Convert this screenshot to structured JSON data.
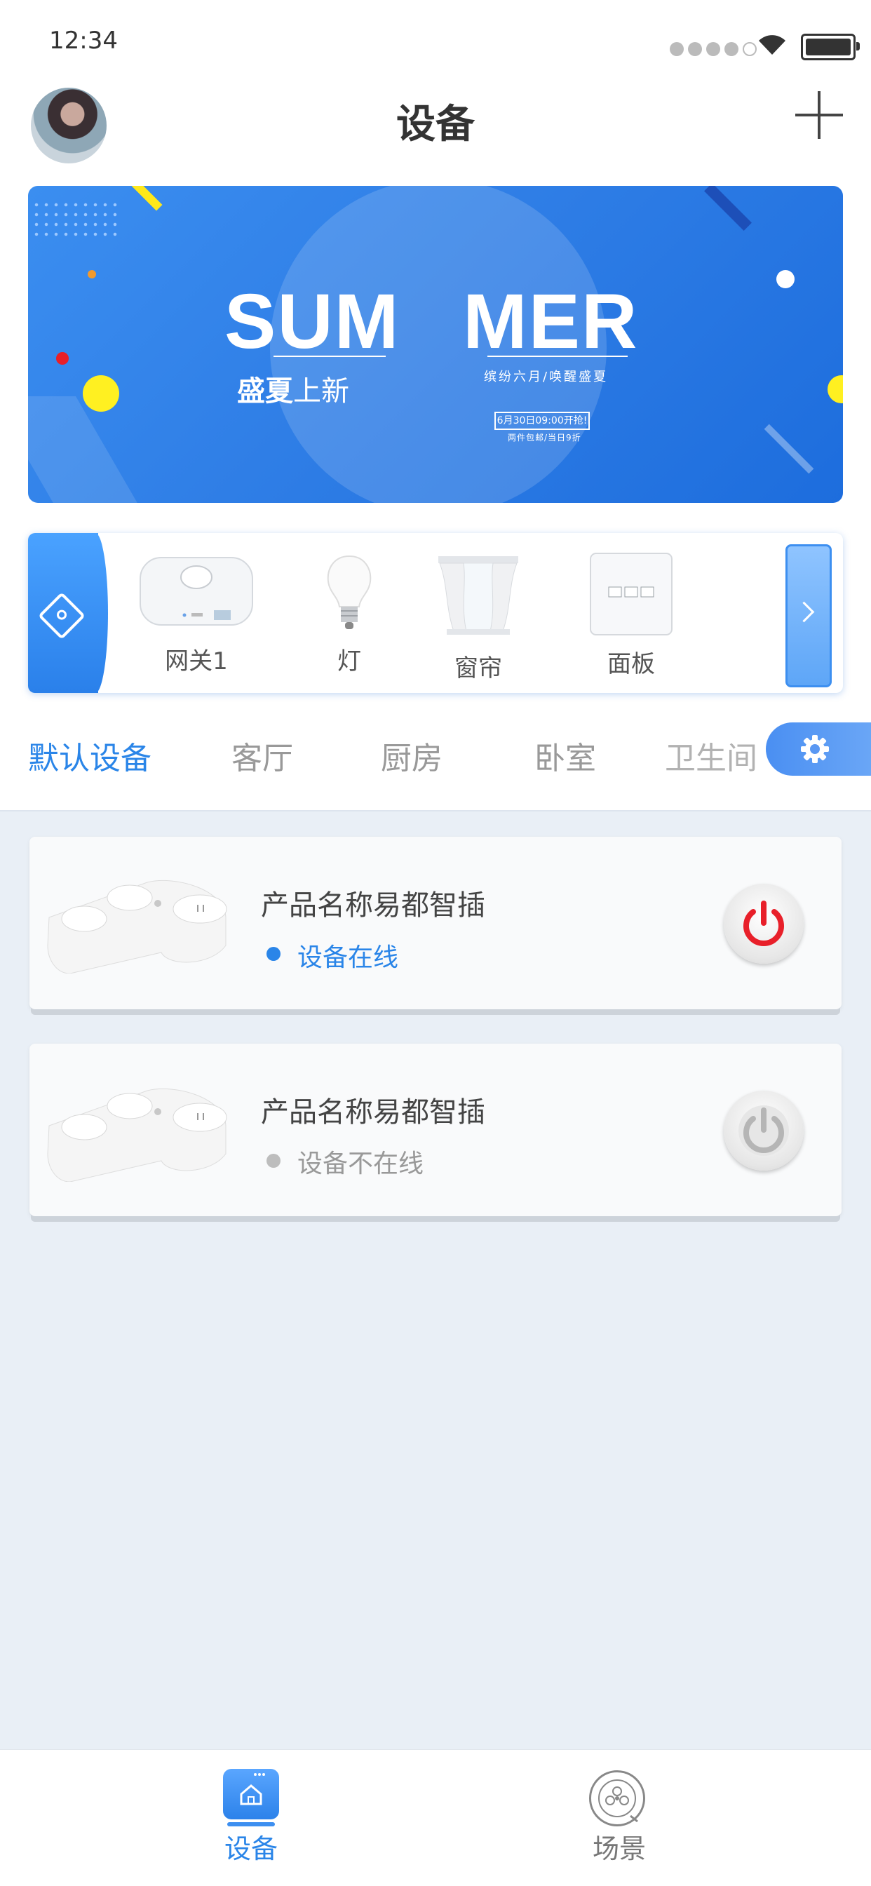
{
  "status_bar": {
    "time": "12:34"
  },
  "header": {
    "title": "设备"
  },
  "banner": {
    "word_left": "SUM",
    "word_right": "MER",
    "subtitle_bold": "盛夏",
    "subtitle_rest": "上新",
    "tagline": "缤纷六月/唤醒盛夏",
    "date_box": "6月30日09:00开抢!",
    "shipping": "两件包邮/当日9折"
  },
  "categories": [
    {
      "label": "网关1",
      "icon": "gateway-icon"
    },
    {
      "label": "灯",
      "icon": "bulb-icon"
    },
    {
      "label": "窗帘",
      "icon": "curtain-icon"
    },
    {
      "label": "面板",
      "icon": "panel-icon"
    }
  ],
  "rooms": {
    "active": "默认设备",
    "items": [
      "默认设备",
      "客厅",
      "厨房",
      "卧室",
      "卫生间"
    ]
  },
  "devices": [
    {
      "name": "产品名称易都智插",
      "status": "设备在线",
      "status_color": "#2a85e8",
      "power_color": "#e8202a"
    },
    {
      "name": "产品名称易都智插",
      "status": "设备不在线",
      "status_color": "#999999",
      "power_color": "#b5b5b5"
    }
  ],
  "bottom_nav": {
    "devices": "设备",
    "scenes": "场景"
  },
  "colors": {
    "accent": "#2a85e8",
    "background": "#e9eff6"
  }
}
